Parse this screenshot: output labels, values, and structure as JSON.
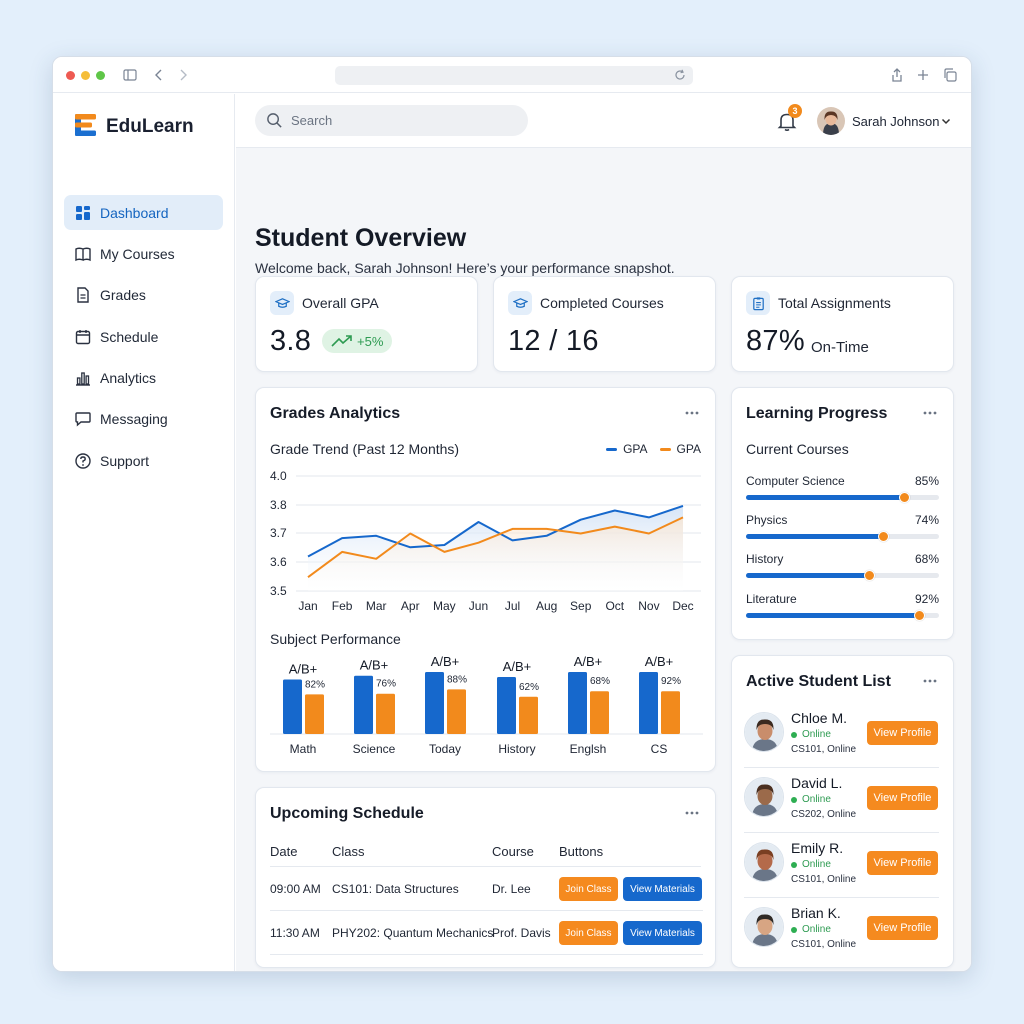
{
  "brand": {
    "name": "EduLearn"
  },
  "sidebar": {
    "items": [
      {
        "label": "Dashboard",
        "icon": "dashboard-icon",
        "active": true
      },
      {
        "label": "My Courses",
        "icon": "book-icon"
      },
      {
        "label": "Grades",
        "icon": "document-icon"
      },
      {
        "label": "Schedule",
        "icon": "calendar-icon"
      },
      {
        "label": "Analytics",
        "icon": "bar-chart-icon"
      },
      {
        "label": "Messaging",
        "icon": "chat-icon"
      },
      {
        "label": "Support",
        "icon": "help-icon"
      }
    ]
  },
  "topbar": {
    "search_placeholder": "Search",
    "notification_count": "3",
    "user_name": "Sarah Johnson"
  },
  "page": {
    "title": "Student Overview",
    "subtitle": "Welcome back, Sarah Johnson! Here’s your performance snapshot."
  },
  "stats": {
    "gpa": {
      "title": "Overall GPA",
      "value": "3.8",
      "change": "+5%"
    },
    "completed": {
      "title": "Completed Courses",
      "value": "12 / 16"
    },
    "assignments": {
      "title": "Total Assignments",
      "value": "87%",
      "suffix": "On-Time"
    }
  },
  "grades": {
    "title": "Grades Analytics",
    "trend_title": "Grade Trend (Past 12 Months)",
    "subject_title": "Subject Performance"
  },
  "colors": {
    "primary": "#1668cc",
    "accent": "#f28a1c",
    "success": "#2e9b52"
  },
  "chart_data": [
    {
      "type": "line",
      "title": "Grade Trend (Past 12 Months)",
      "x": [
        "Jan",
        "Feb",
        "Mar",
        "Apr",
        "May",
        "Jun",
        "Jul",
        "Aug",
        "Sep",
        "Oct",
        "Nov",
        "Dec"
      ],
      "series": [
        {
          "name": "GPA",
          "color": "#1668cc",
          "values": [
            3.65,
            3.73,
            3.74,
            3.69,
            3.7,
            3.8,
            3.72,
            3.74,
            3.81,
            3.85,
            3.82,
            3.87
          ]
        },
        {
          "name": "GPA",
          "color": "#f28a1c",
          "values": [
            3.56,
            3.67,
            3.64,
            3.75,
            3.67,
            3.71,
            3.77,
            3.77,
            3.75,
            3.78,
            3.75,
            3.82
          ]
        }
      ],
      "yticks": [
        "4.0",
        "3.8",
        "3.7",
        "3.6",
        "3.5"
      ],
      "ylim": [
        3.5,
        4.0
      ],
      "grid": true,
      "legend": "top-right"
    },
    {
      "type": "bar",
      "title": "Subject Performance",
      "categories": [
        "Math",
        "Science",
        "Today",
        "History",
        "Englsh",
        "CS"
      ],
      "grade_labels": [
        "A/B+",
        "A/B+",
        "A/B+",
        "A/B+",
        "A/B+",
        "A/B+"
      ],
      "series": [
        {
          "color": "#1668cc",
          "values": [
            88,
            94,
            100,
            92,
            100,
            100
          ]
        },
        {
          "color": "#f28a1c",
          "values": [
            64,
            65,
            72,
            60,
            69,
            69
          ]
        }
      ],
      "value_labels": [
        "82%",
        "76%",
        "88%",
        "62%",
        "68%",
        "92%"
      ]
    }
  ],
  "progress": {
    "title": "Learning Progress",
    "subtitle": "Current Courses",
    "courses": [
      {
        "name": "Computer Science",
        "pct_label": "85%",
        "fill": 0.82
      },
      {
        "name": "Physics",
        "pct_label": "74%",
        "fill": 0.71
      },
      {
        "name": "History",
        "pct_label": "68%",
        "fill": 0.64
      },
      {
        "name": "Literature",
        "pct_label": "92%",
        "fill": 0.9
      }
    ]
  },
  "students": {
    "title": "Active Student List",
    "button_label": "View Profile",
    "list": [
      {
        "name": "Chloe M.",
        "status": "Online",
        "course": "CS101, Online",
        "avatar_color": "#c98d6b"
      },
      {
        "name": "David L.",
        "status": "Online",
        "course": "CS202, Online",
        "avatar_color": "#9b6a4a"
      },
      {
        "name": "Emily R.",
        "status": "Online",
        "course": "CS101, Online",
        "avatar_color": "#b46a4a"
      },
      {
        "name": "Brian K.",
        "status": "Online",
        "course": "CS101, Online",
        "avatar_color": "#d7a583"
      }
    ]
  },
  "schedule": {
    "title": "Upcoming Schedule",
    "columns": [
      "Date",
      "Class",
      "Course",
      "Buttons"
    ],
    "rows": [
      {
        "date": "09:00 AM",
        "class": "CS101: Data Structures",
        "course": "Dr. Lee"
      },
      {
        "date": "11:30 AM",
        "class": "PHY202: Quantum Mechanics",
        "course": "Prof. Davis"
      }
    ],
    "join_label": "Join Class",
    "materials_label": "View Materials"
  }
}
